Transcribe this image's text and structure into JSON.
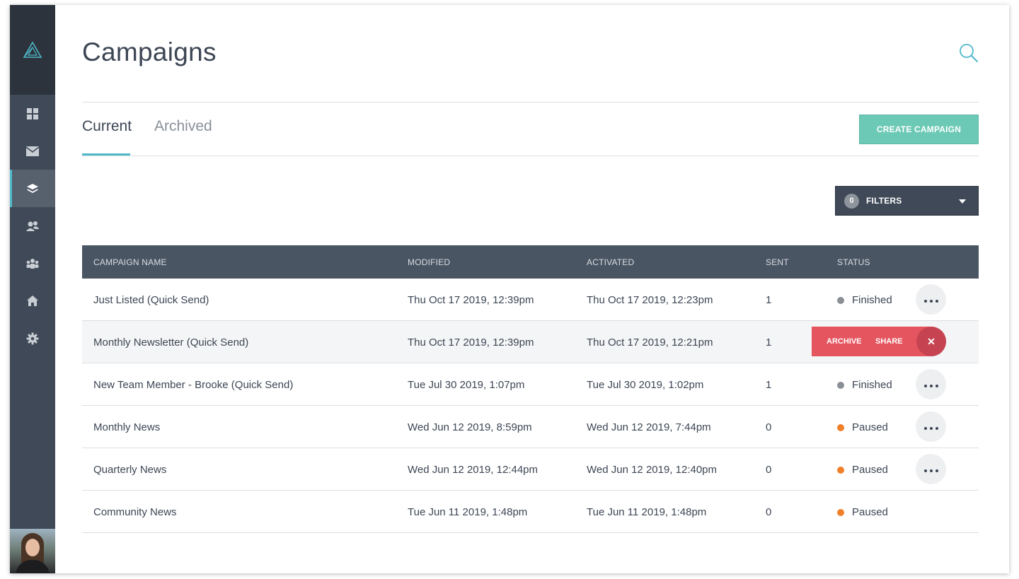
{
  "header": {
    "title": "Campaigns"
  },
  "tabs": [
    {
      "label": "Current",
      "active": true
    },
    {
      "label": "Archived",
      "active": false
    }
  ],
  "create_button": "CREATE CAMPAIGN",
  "filters": {
    "count": "0",
    "label": "FILTERS"
  },
  "table": {
    "columns": [
      "CAMPAIGN NAME",
      "MODIFIED",
      "ACTIVATED",
      "SENT",
      "STATUS"
    ],
    "rows": [
      {
        "name": "Just Listed (Quick Send)",
        "modified": "Thu Oct 17 2019, 12:39pm",
        "activated": "Thu Oct 17 2019, 12:23pm",
        "sent": "1",
        "status": "Finished"
      },
      {
        "name": "Monthly Newsletter (Quick Send)",
        "modified": "Thu Oct 17 2019, 12:39pm",
        "activated": "Thu Oct 17 2019, 12:21pm",
        "sent": "1",
        "status": ""
      },
      {
        "name": "New Team Member - Brooke (Quick Send)",
        "modified": "Tue Jul 30 2019, 1:07pm",
        "activated": "Tue Jul 30 2019, 1:02pm",
        "sent": "1",
        "status": "Finished"
      },
      {
        "name": "Monthly News",
        "modified": "Wed Jun 12 2019, 8:59pm",
        "activated": "Wed Jun 12 2019, 7:44pm",
        "sent": "0",
        "status": "Paused"
      },
      {
        "name": "Quarterly News",
        "modified": "Wed Jun 12 2019, 12:44pm",
        "activated": "Wed Jun 12 2019, 12:40pm",
        "sent": "0",
        "status": "Paused"
      },
      {
        "name": "Community News",
        "modified": "Tue Jun 11 2019, 1:48pm",
        "activated": "Tue Jun 11 2019, 1:48pm",
        "sent": "0",
        "status": "Paused"
      }
    ]
  },
  "row_actions": {
    "archive": "ARCHIVE",
    "share": "SHARE",
    "close": "✕"
  },
  "sidebar": {
    "items": [
      {
        "icon": "dashboard-icon",
        "active": false
      },
      {
        "icon": "envelope-icon",
        "active": false
      },
      {
        "icon": "layers-icon",
        "active": true
      },
      {
        "icon": "contacts-icon",
        "active": false
      },
      {
        "icon": "team-icon",
        "active": false
      },
      {
        "icon": "home-icon",
        "active": false
      },
      {
        "icon": "gear-icon",
        "active": false
      }
    ]
  },
  "colors": {
    "accent": "#4fb8c9",
    "create_button": "#6cc9b6",
    "status_finished": "#8a8f96",
    "status_paused": "#f07f2a",
    "action_bar": "#e5555f",
    "sidebar": "#3f4957"
  }
}
